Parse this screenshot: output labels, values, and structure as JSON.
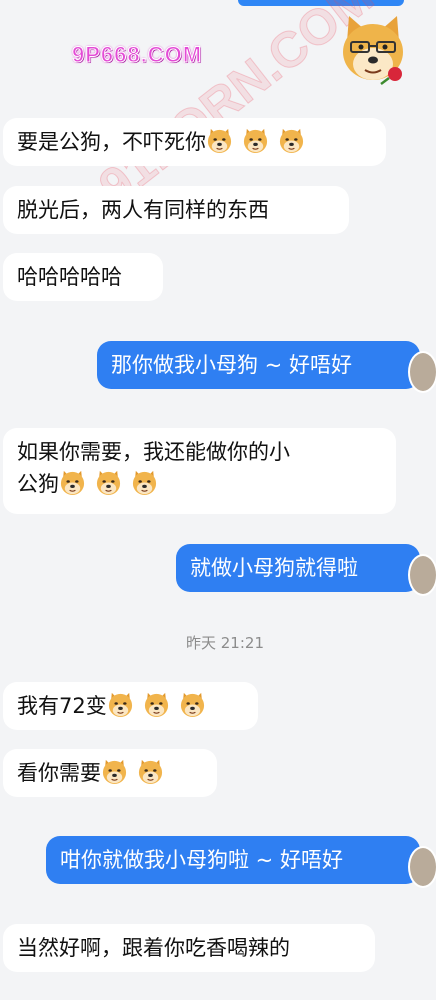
{
  "watermark": {
    "site": "9P668.COM",
    "diagonal": "91PORN.COM"
  },
  "messages": [
    {
      "id": "m1",
      "side": "in",
      "text": "要是公狗，不吓死你",
      "emojis": 3
    },
    {
      "id": "m2",
      "side": "in",
      "text": "脱光后，两人有同样的东西",
      "emojis": 0
    },
    {
      "id": "m3",
      "side": "in",
      "text": "哈哈哈哈哈",
      "emojis": 0
    },
    {
      "id": "m4",
      "side": "out",
      "text": "那你做我小母狗 ~ 好唔好",
      "emojis": 0
    },
    {
      "id": "m5",
      "side": "in",
      "line1": "如果你需要，我还能做你的小",
      "line2": "公狗",
      "emojis": 3
    },
    {
      "id": "m6",
      "side": "out",
      "text": "就做小母狗就得啦",
      "emojis": 0
    },
    {
      "id": "m7",
      "side": "in",
      "text": "我有72变",
      "emojis": 3
    },
    {
      "id": "m8",
      "side": "in",
      "text": "看你需要",
      "emojis": 2
    },
    {
      "id": "m9",
      "side": "out",
      "text": "咁你就做我小母狗啦 ~ 好唔好",
      "emojis": 0
    },
    {
      "id": "m10",
      "side": "in",
      "text": "当然好啊，跟着你吃香喝辣的",
      "emojis": 0
    }
  ],
  "timestamp": "昨天 21:21",
  "emoji_name": "doge-emoji",
  "colors": {
    "outgoing": "#2f7ff2",
    "incoming": "#ffffff",
    "background": "#f3f4f6"
  }
}
